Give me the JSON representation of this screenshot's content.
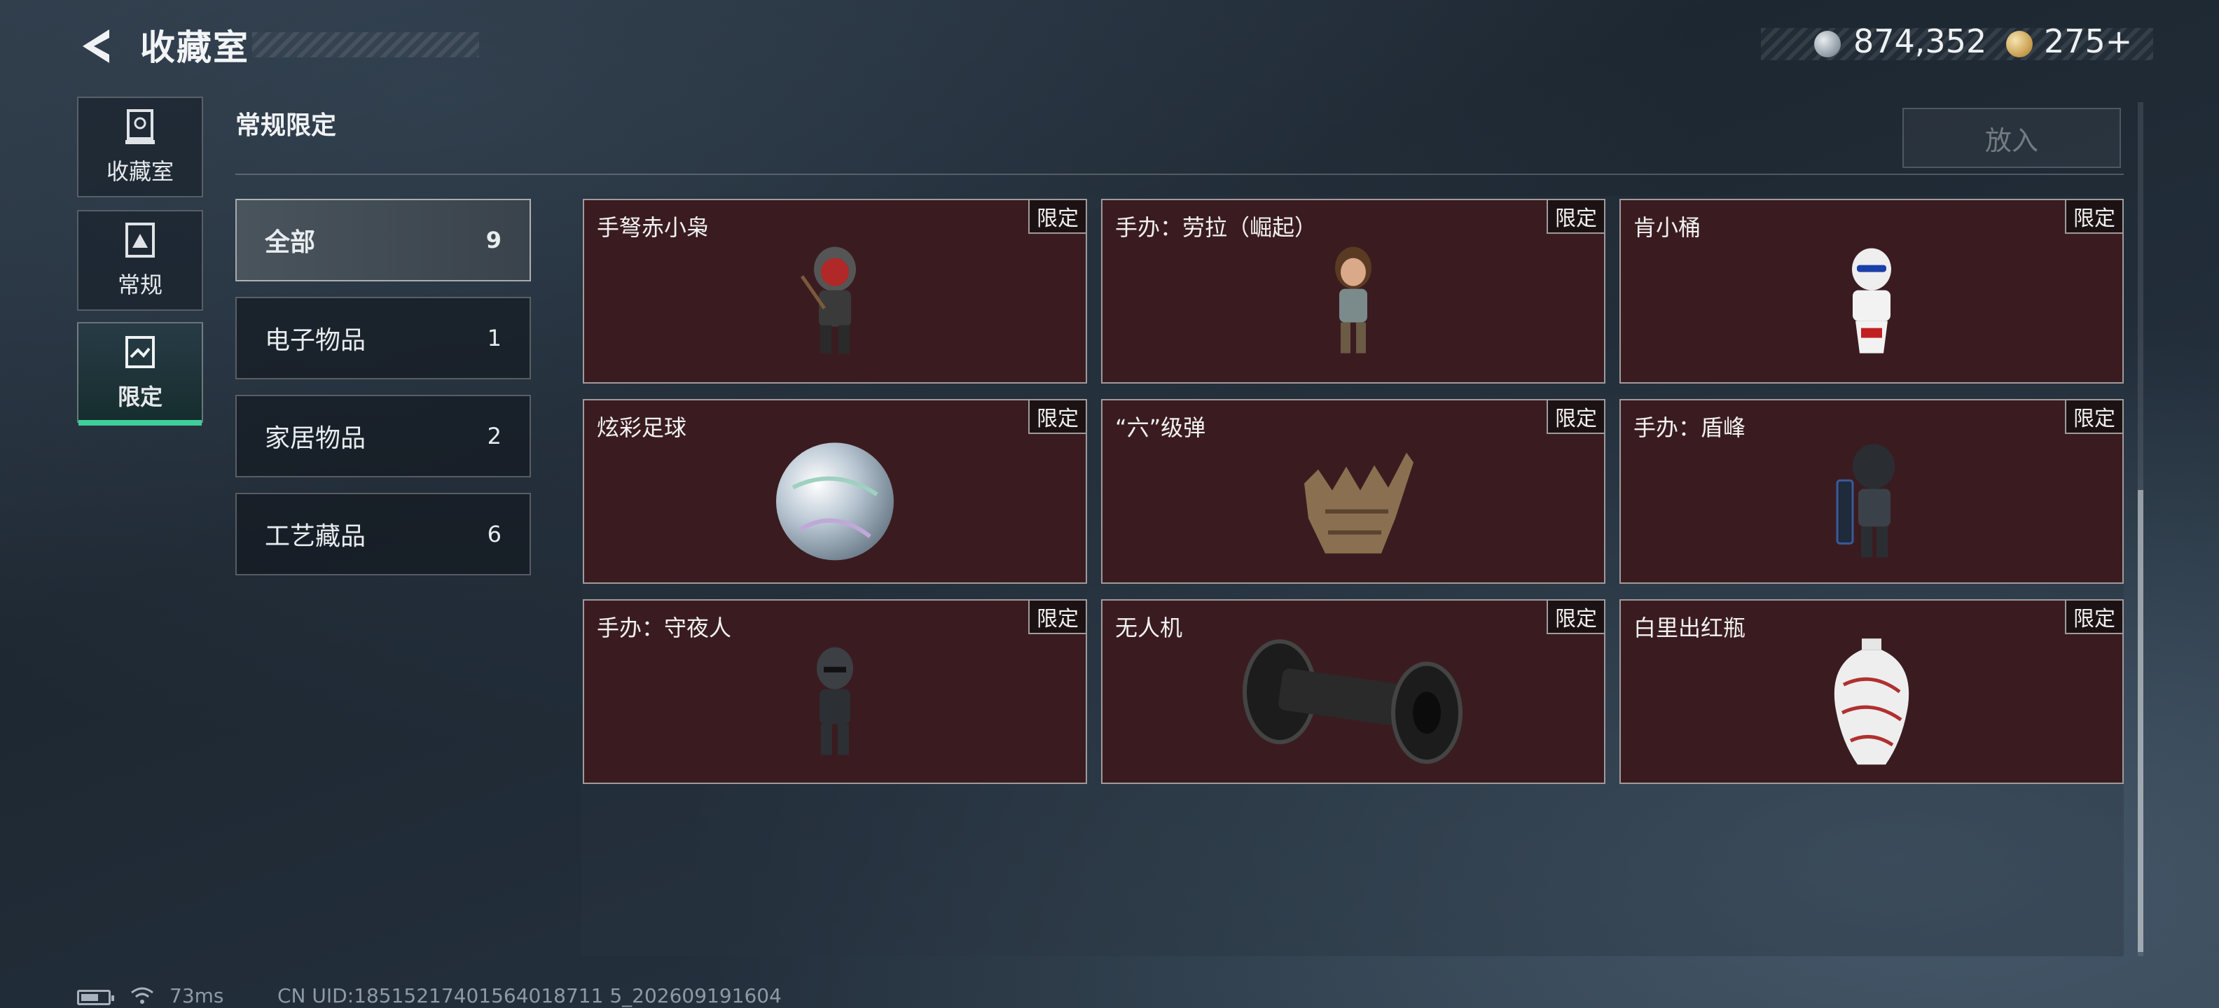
{
  "header": {
    "title": "收藏室",
    "silver": "874,352",
    "gold": "275+"
  },
  "nav": [
    {
      "label": "收藏室",
      "icon": "trophy-icon"
    },
    {
      "label": "常规",
      "icon": "card-icon"
    },
    {
      "label": "限定",
      "icon": "limited-icon",
      "active": true
    }
  ],
  "section": {
    "title": "常规限定",
    "put_button": "放入"
  },
  "categories": [
    {
      "label": "全部",
      "count": "9",
      "active": true
    },
    {
      "label": "电子物品",
      "count": "1"
    },
    {
      "label": "家居物品",
      "count": "2"
    },
    {
      "label": "工艺藏品",
      "count": "6"
    }
  ],
  "items": [
    {
      "name": "手弩赤小枭",
      "tag": "限定",
      "icon": "hooded-figure-icon"
    },
    {
      "name": "手办：劳拉（崛起）",
      "tag": "限定",
      "icon": "explorer-figure-icon"
    },
    {
      "name": "肯小桶",
      "tag": "限定",
      "icon": "bucket-figure-icon"
    },
    {
      "name": "炫彩足球",
      "tag": "限定",
      "icon": "iridescent-ball-icon"
    },
    {
      "name": "“六”级弹",
      "tag": "限定",
      "icon": "hand-bullets-icon"
    },
    {
      "name": "手办：盾峰",
      "tag": "限定",
      "icon": "shield-soldier-icon"
    },
    {
      "name": "手办：守夜人",
      "tag": "限定",
      "icon": "masked-figure-icon"
    },
    {
      "name": "无人机",
      "tag": "限定",
      "icon": "drone-wheels-icon"
    },
    {
      "name": "白里出红瓶",
      "tag": "限定",
      "icon": "porcelain-vase-icon"
    }
  ],
  "status": {
    "ping": "73ms",
    "uid": "CN UID:18515217401564018711 5_202609191604"
  },
  "colors": {
    "accent": "#3fcf9a",
    "card_bg": "#3a1c20"
  }
}
